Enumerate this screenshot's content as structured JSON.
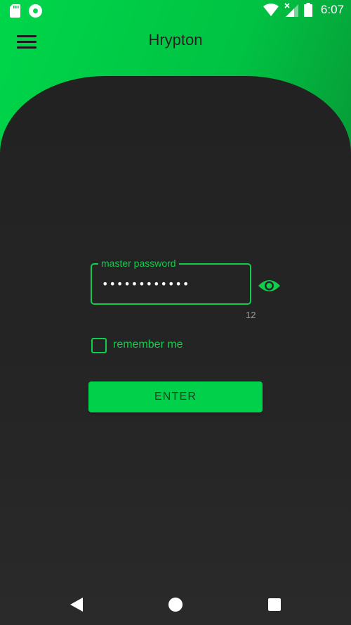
{
  "status_bar": {
    "time": "6:07",
    "icons": [
      "sd-card-icon",
      "notification-icon",
      "wifi-icon",
      "signal-icon",
      "battery-icon"
    ]
  },
  "app_bar": {
    "title": "Hrypton",
    "menu_icon": "menu-icon"
  },
  "login": {
    "password_label": "master password",
    "password_value": "••••••••••••",
    "char_count": "12",
    "visibility_icon": "eye-icon",
    "remember_label": "remember me",
    "remember_checked": false,
    "enter_label": "ENTER"
  },
  "nav_bar": {
    "icons": [
      "back-icon",
      "home-icon",
      "recents-icon"
    ]
  },
  "colors": {
    "accent": "#12cc4b",
    "button": "#00d04a",
    "card": "#232323",
    "header_gradient_start": "#00d64a",
    "header_gradient_end": "#076e27"
  }
}
